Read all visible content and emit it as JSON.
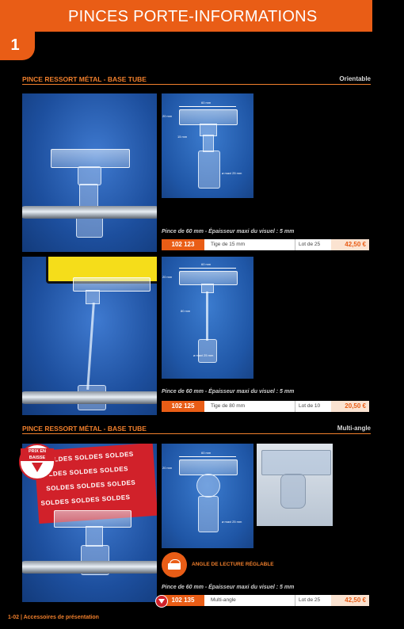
{
  "header": {
    "title": "PINCES PORTE-INFORMATIONS",
    "chapter": "1"
  },
  "sections": [
    {
      "title": "PINCE RESSORT MÉTAL - BASE TUBE",
      "tag": "Orientable"
    },
    {
      "title": "PINCE RESSORT MÉTAL - BASE TUBE",
      "tag": "Multi-angle"
    }
  ],
  "products": [
    {
      "dims": {
        "width": "60 mm",
        "height": "20 mm",
        "stem": "15 mm",
        "tube": "ø maxi 25 mm"
      },
      "caption": "Pince de 60 mm - Épaisseur maxi du visuel : 5 mm",
      "ref": "102 123",
      "desc": "Tige de 15 mm",
      "lot": "Lot de 25",
      "price": "42,50 €"
    },
    {
      "dims": {
        "width": "60 mm",
        "height": "20 mm",
        "stem": "80 mm",
        "tube": "ø maxi 25 mm"
      },
      "caption": "Pince de 60 mm - Épaisseur maxi du visuel : 5 mm",
      "ref": "102 125",
      "desc": "Tige de 80 mm",
      "lot": "Lot de 10",
      "price": "20,50 €"
    },
    {
      "dims": {
        "width": "60 mm",
        "height": "20 mm",
        "tube": "ø maxi 25 mm"
      },
      "feature": "ANGLE DE LECTURE RÉGLABLE",
      "caption": "Pince de 60 mm - Épaisseur maxi du visuel : 5 mm",
      "ref": "102 135",
      "desc": "Multi-angle",
      "lot": "Lot de 25",
      "price": "42,50 €"
    }
  ],
  "signs": {
    "promo": "SOLDES",
    "promo_tile": "SOLDES SOLDES SOLDES",
    "badge_top": "PRIX EN",
    "badge_bottom": "BAISSE"
  },
  "footer": {
    "text": "1-02 | Accessoires de présentation"
  },
  "colors": {
    "accent": "#e95d16",
    "price_bg": "#fbe3d1",
    "photo_blue": "#1d4f9e"
  }
}
